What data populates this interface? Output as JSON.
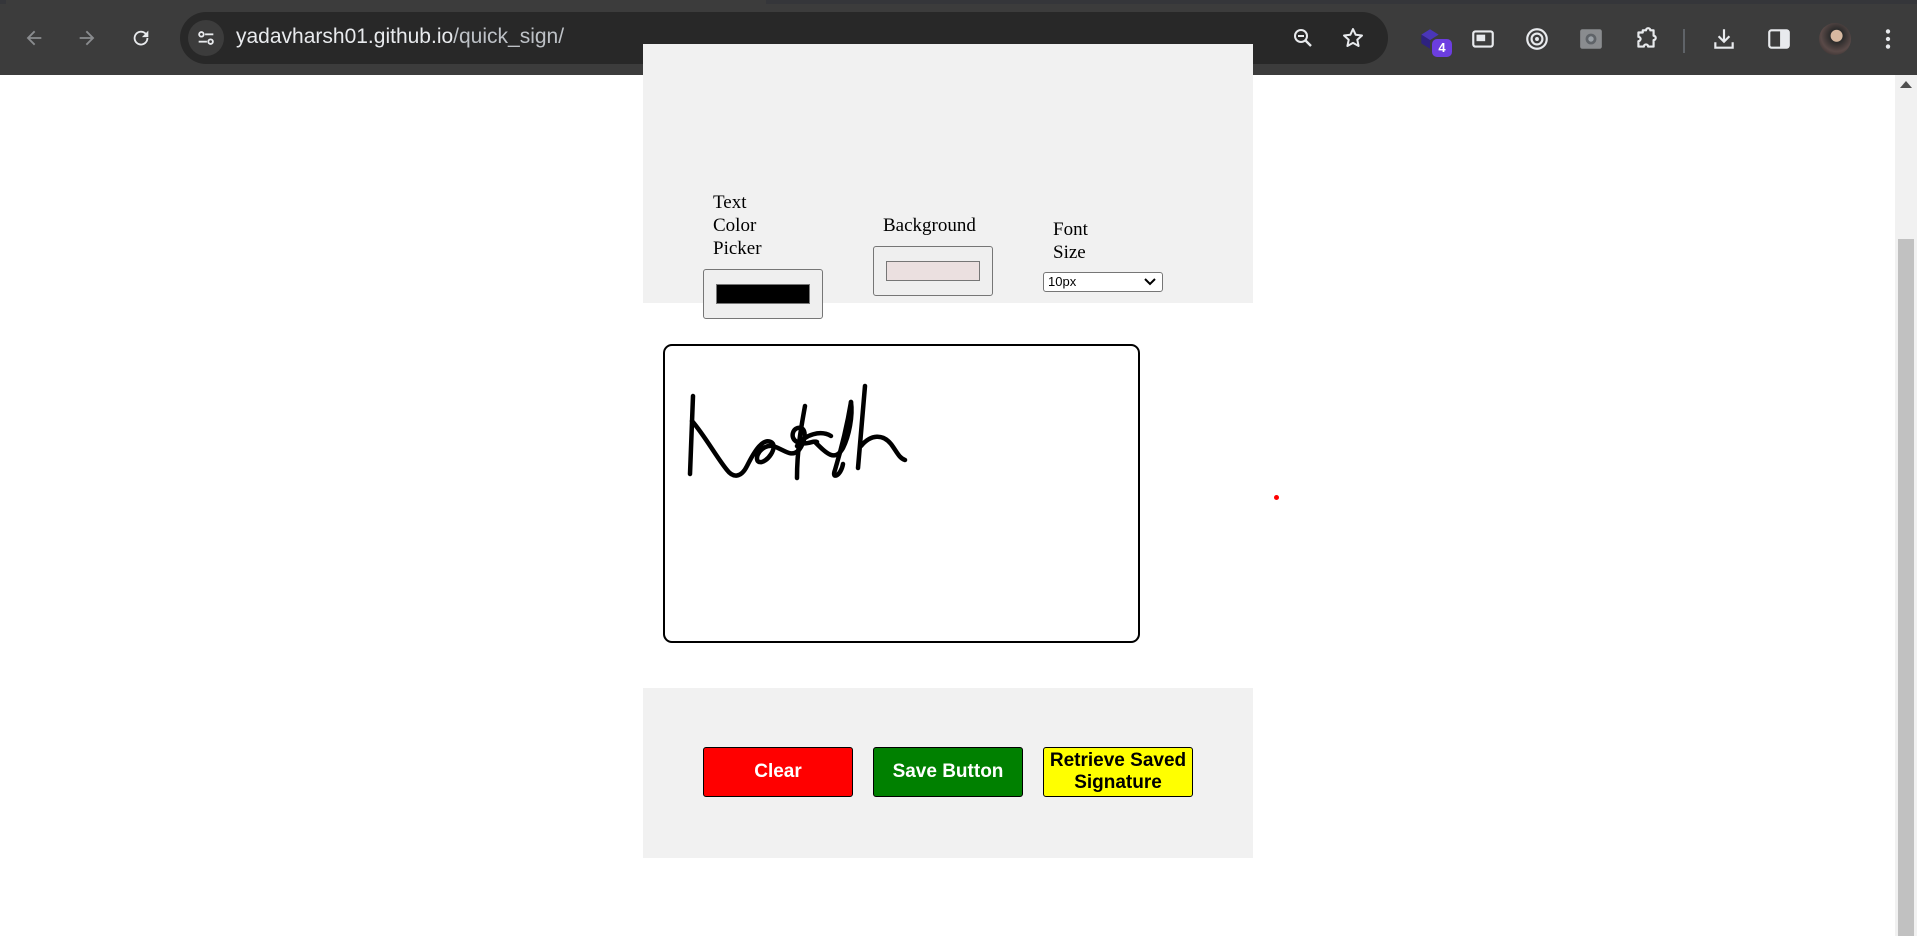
{
  "browser": {
    "url_host": "yadavharsh01.github.io",
    "url_path": "/quick_sign/",
    "extension_badge": "4"
  },
  "controls": {
    "text_color_label_lines": [
      "Text",
      "Color",
      "Picker"
    ],
    "text_color_value": "#000000",
    "background_label": "Background",
    "background_value": "#ebe0e0",
    "font_size_label_lines": [
      "Font",
      "Size"
    ],
    "font_size_value": "10px"
  },
  "signature": {
    "stroke_color": "#000000",
    "text": "harsh"
  },
  "buttons": {
    "clear": "Clear",
    "save": "Save Button",
    "retrieve": "Retrieve Saved Signature"
  },
  "colors": {
    "clear_bg": "#ff0000",
    "save_bg": "#008000",
    "retrieve_bg": "#ffff00",
    "panel_bg": "#f1f1f1"
  },
  "icons": [
    "back-arrow-icon",
    "forward-arrow-icon",
    "reload-icon",
    "site-info-icon",
    "zoom-icon",
    "bookmark-star-icon",
    "extension-icon",
    "picture-in-picture-icon",
    "target-icon",
    "camera-icon",
    "puzzle-icon",
    "download-icon",
    "side-panel-icon",
    "kebab-menu-icon"
  ]
}
